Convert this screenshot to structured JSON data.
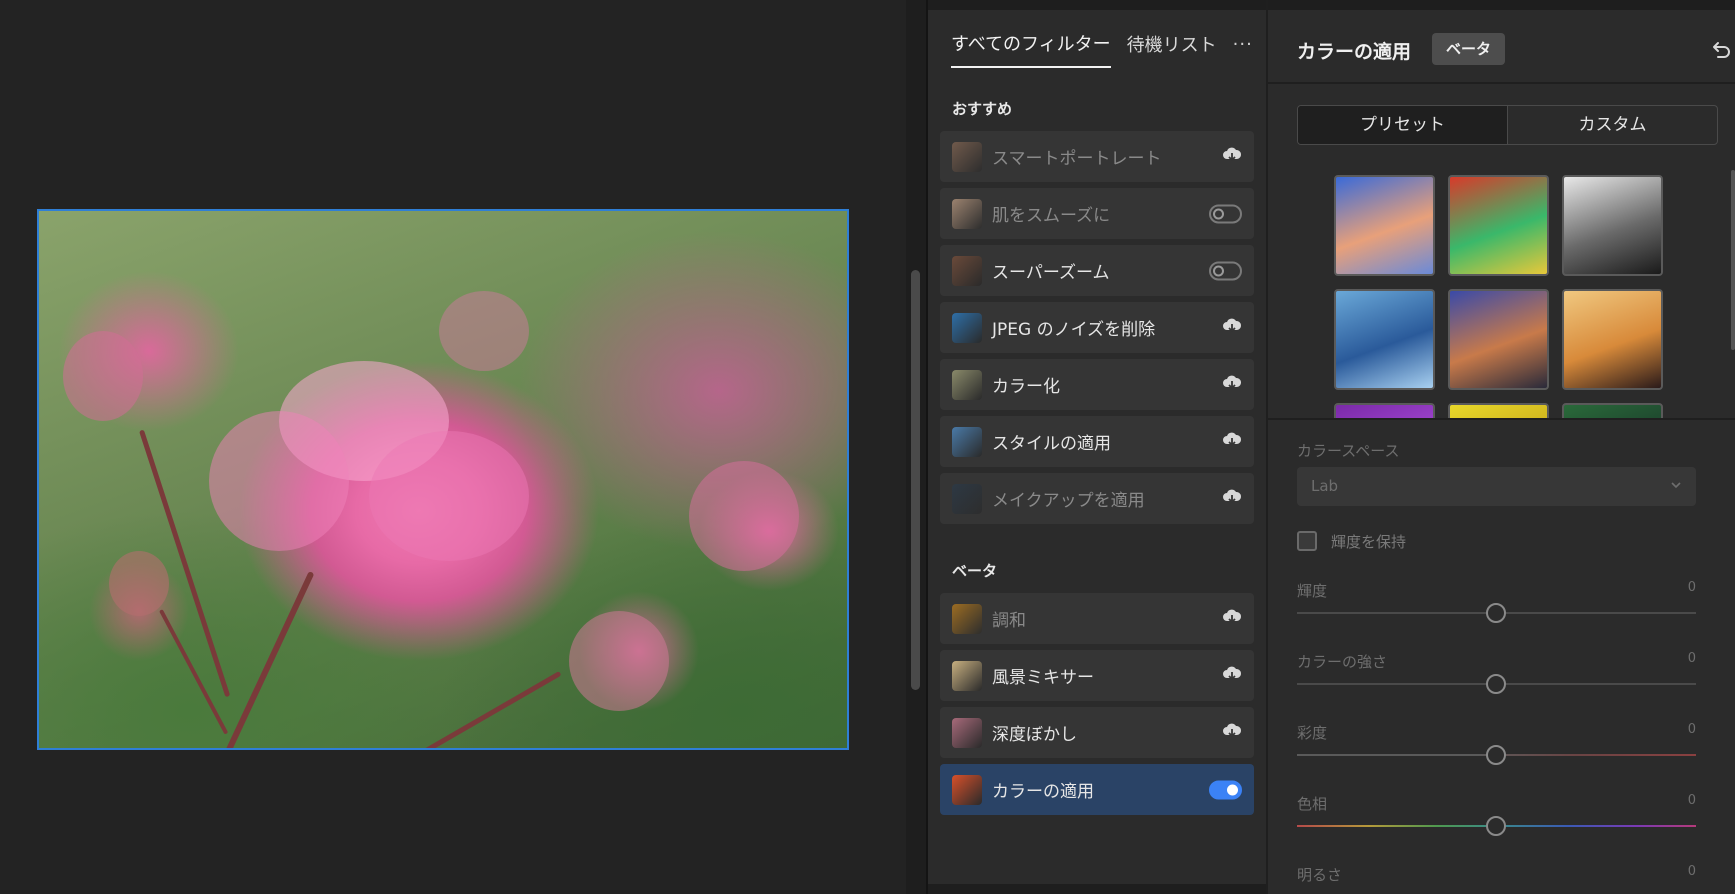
{
  "filters_panel": {
    "tabs": [
      "すべてのフィルター",
      "待機リスト"
    ],
    "more_label": "···",
    "sections": [
      {
        "title": "おすすめ",
        "items": [
          {
            "label": "スマートポートレート",
            "control": "cloud",
            "dim": true,
            "selected": false,
            "icon": "portrait-thumb-icon",
            "thumb_color": "#8a6a55"
          },
          {
            "label": "肌をスムーズに",
            "control": "toggle-off",
            "dim": true,
            "selected": false,
            "icon": "skin-thumb-icon",
            "thumb_color": "#c8a488"
          },
          {
            "label": "スーパーズーム",
            "control": "toggle-off",
            "dim": false,
            "selected": false,
            "icon": "zoom-thumb-icon",
            "thumb_color": "#6a4a3a"
          },
          {
            "label": "JPEG のノイズを削除",
            "control": "cloud",
            "dim": false,
            "selected": false,
            "icon": "jpeg-thumb-icon",
            "thumb_color": "#2e6fa8"
          },
          {
            "label": "カラー化",
            "control": "cloud",
            "dim": false,
            "selected": false,
            "icon": "colorize-thumb-icon",
            "thumb_color": "#8a8a6a"
          },
          {
            "label": "スタイルの適用",
            "control": "cloud",
            "dim": false,
            "selected": false,
            "icon": "style-thumb-icon",
            "thumb_color": "#4a7aa8"
          },
          {
            "label": "メイクアップを適用",
            "control": "cloud",
            "dim": true,
            "selected": false,
            "icon": "makeup-thumb-icon",
            "thumb_color": "#2a3a4a"
          }
        ]
      },
      {
        "title": "ベータ",
        "items": [
          {
            "label": "調和",
            "control": "cloud",
            "dim": true,
            "selected": false,
            "icon": "harmony-thumb-icon",
            "thumb_color": "#c8841a"
          },
          {
            "label": "風景ミキサー",
            "control": "cloud",
            "dim": false,
            "selected": false,
            "icon": "landscape-thumb-icon",
            "thumb_color": "#c8b080"
          },
          {
            "label": "深度ぼかし",
            "control": "cloud",
            "dim": false,
            "selected": false,
            "icon": "depth-blur-thumb-icon",
            "thumb_color": "#a86a7a"
          },
          {
            "label": "カラーの適用",
            "control": "toggle-on",
            "dim": false,
            "selected": true,
            "icon": "color-transfer-thumb-icon",
            "thumb_color": "#d8502a"
          }
        ]
      }
    ]
  },
  "settings_panel": {
    "title": "カラーの適用",
    "badge": "ベータ",
    "segments": [
      "プリセット",
      "カスタム"
    ],
    "presets": [
      {
        "name": "sunset-lake-preset",
        "colors": [
          "#3a6ad8",
          "#e8a07a",
          "#6a8ad8"
        ]
      },
      {
        "name": "abstract-paint-preset",
        "colors": [
          "#d83a2a",
          "#3ab86a",
          "#e8c83a"
        ]
      },
      {
        "name": "arches-bw-preset",
        "colors": [
          "#e8e8e8",
          "#6a6a6a",
          "#1a1a1a"
        ]
      },
      {
        "name": "blue-feathers-preset",
        "colors": [
          "#6aa8d8",
          "#2a5a9a",
          "#a8d0f0"
        ]
      },
      {
        "name": "desert-road-preset",
        "colors": [
          "#3a4aa8",
          "#c87a4a",
          "#2a2a3a"
        ]
      },
      {
        "name": "skater-preset",
        "colors": [
          "#f0c880",
          "#d88a3a",
          "#2a1a1a"
        ]
      },
      {
        "name": "purple-flower-preset",
        "colors": [
          "#7a2aa8",
          "#a84ad8",
          "#3a1a5a"
        ]
      },
      {
        "name": "yellow-preset",
        "colors": [
          "#e8d82a",
          "#c8a81a",
          "#f0e87a"
        ]
      },
      {
        "name": "green-leaves-preset",
        "colors": [
          "#2a6a3a",
          "#1a3a2a",
          "#5a9a5a"
        ]
      }
    ],
    "color_space_label": "カラースペース",
    "color_space_value": "Lab",
    "keep_luminance_label": "輝度を保持",
    "sliders": [
      {
        "label": "輝度",
        "value": "0",
        "track": "plain"
      },
      {
        "label": "カラーの強さ",
        "value": "0",
        "track": "plain"
      },
      {
        "label": "彩度",
        "value": "0",
        "track": "sat"
      },
      {
        "label": "色相",
        "value": "0",
        "track": "hue"
      },
      {
        "label": "明るさ",
        "value": "0",
        "track": "plain"
      }
    ]
  },
  "colors": {
    "accent": "#3b82f6",
    "selected_row": "#2a4366",
    "photo_border": "#2f7fd6"
  }
}
